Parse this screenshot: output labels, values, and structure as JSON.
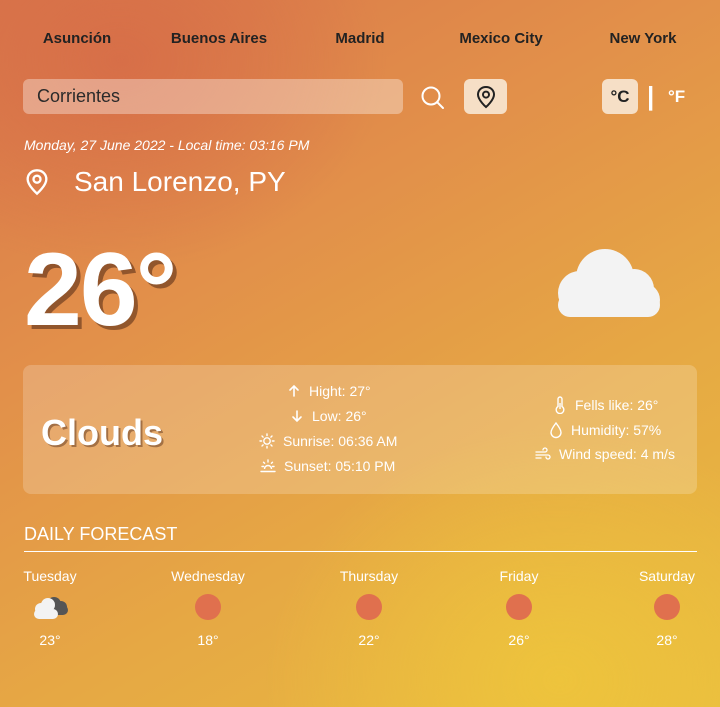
{
  "cities": [
    "Asunción",
    "Buenos Aires",
    "Madrid",
    "Mexico City",
    "New York"
  ],
  "search": {
    "value": "Corrientes"
  },
  "units": {
    "celsius": "°C",
    "separator": "|",
    "fahrenheit": "°F"
  },
  "date_line": "Monday, 27 June 2022 - Local time: 03:16 PM",
  "location": "San Lorenzo, PY",
  "temperature": "26°",
  "condition": "Clouds",
  "details": {
    "high": "Hight: 27°",
    "low": "Low: 26°",
    "sunrise": "Sunrise: 06:36 AM",
    "sunset": "Sunset: 05:10 PM",
    "feels_like": "Fells like: 26°",
    "humidity": "Humidity: 57%",
    "wind": "Wind speed: 4 m/s"
  },
  "forecast": {
    "title": "DAILY FORECAST",
    "days": [
      {
        "name": "Tuesday",
        "temp": "23°",
        "icon": "cloudy-icon"
      },
      {
        "name": "Wednesday",
        "temp": "18°",
        "icon": "sun-dot-icon"
      },
      {
        "name": "Thursday",
        "temp": "22°",
        "icon": "sun-dot-icon"
      },
      {
        "name": "Friday",
        "temp": "26°",
        "icon": "sun-dot-icon"
      },
      {
        "name": "Saturday",
        "temp": "28°",
        "icon": "sun-dot-icon"
      }
    ]
  },
  "colors": {
    "accent": "#f6dfc6",
    "sun_dot": "#e0704e",
    "gradient_start": "#d9764a",
    "gradient_end": "#e9bd3f"
  }
}
